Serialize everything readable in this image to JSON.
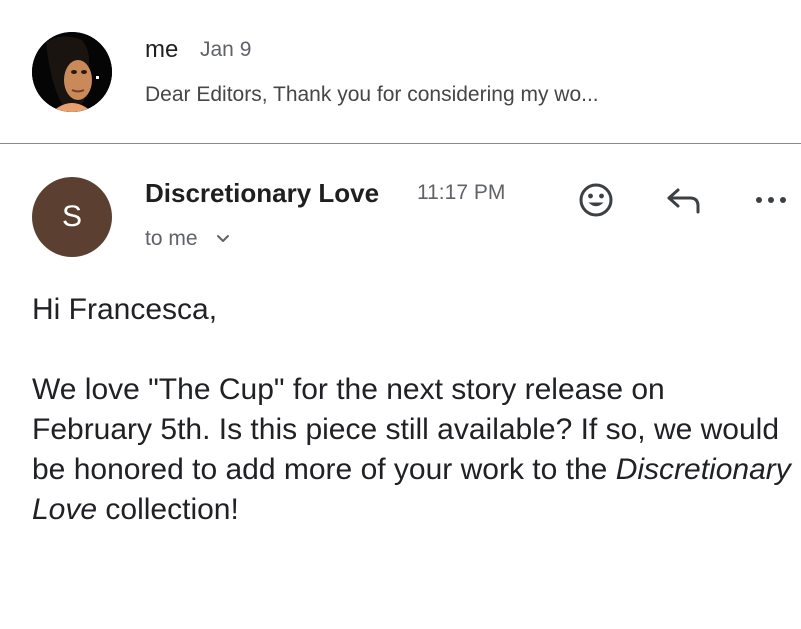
{
  "collapsed_message": {
    "sender": "me",
    "date": "Jan 9",
    "snippet": "Dear Editors, Thank you for considering my wo..."
  },
  "expanded_message": {
    "avatar_letter": "S",
    "avatar_color": "#5b4032",
    "sender": "Discretionary Love",
    "time": "11:17 PM",
    "recipients_label": "to me",
    "actions": [
      {
        "icon": "smiley-face-icon"
      },
      {
        "icon": "reply-arrow-icon"
      },
      {
        "icon": "more-horizontal-icon"
      }
    ],
    "body": {
      "greeting": "Hi Francesca,",
      "paragraph_text": "We love \"The Cup\" for the next story release on February 5th. Is this piece still available? If so, we would be honored to add more of your work to the",
      "paragraph_italic": "Discretionary Love",
      "paragraph_tail": "collection!"
    }
  }
}
